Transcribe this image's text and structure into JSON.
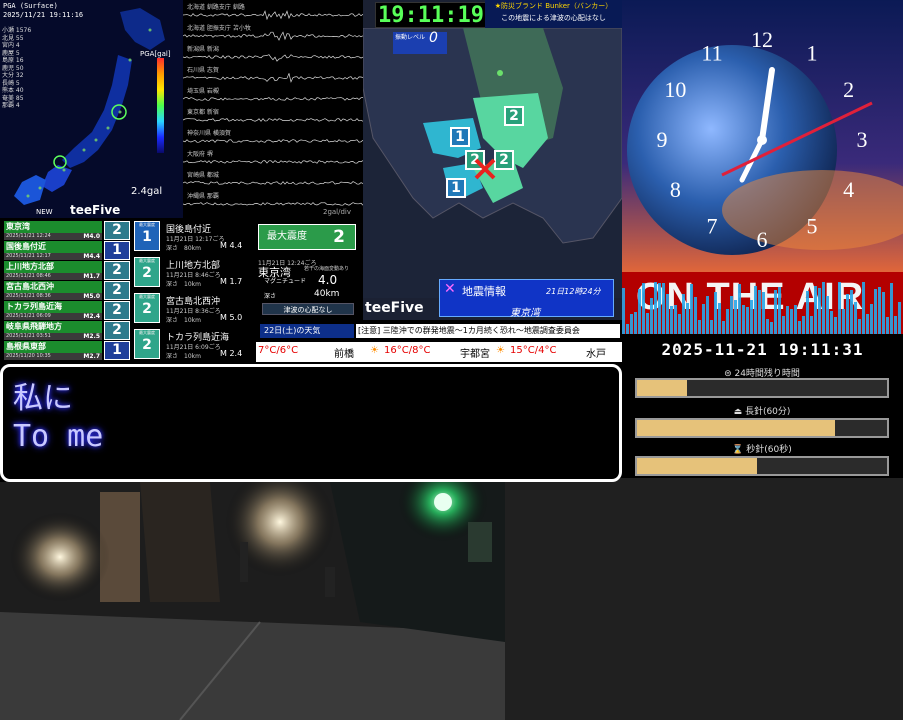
{
  "pga_panel": {
    "title": "PGA (Surface)",
    "timestamp": "2025/11/21 19:11:16",
    "legend": [
      "小瀬 1576",
      "北見 55",
      "宮内 4",
      "鹿屋 5",
      "島原 16",
      "鹿児 50",
      "大分 32",
      "長崎 5",
      "熊本 40",
      "奄美 85",
      "那覇 4"
    ],
    "scale_label": "PGA[gal]",
    "gal_value": "2.4gal",
    "new_label": "NEW",
    "brand": "teeFive",
    "colors": {
      "accent": "#1b8c2d"
    }
  },
  "seismograms": {
    "stations": [
      "北海道 釧路支庁 釧路",
      "北海道 胆振支庁 苫小牧",
      "新潟県 新潟",
      "石川県 志賀",
      "埼玉県 岩槻",
      "東京都 新宿",
      "神奈川県 横須賀",
      "大阪府 堺",
      "宮崎県 都城",
      "沖縄県 那覇"
    ],
    "footer": "2gal/div"
  },
  "kanto_map": {
    "clock": "19:11:19",
    "bunker_line1": "★防災ブランド Bunker（バンカー）",
    "bunker_line2": "この地震による津波の心配はなし",
    "level_label": "振動レベル",
    "level_value": "0",
    "intensity_marks": [
      "2",
      "1",
      "2",
      "2",
      "1"
    ],
    "brand": "teeFive",
    "info_title": "地震情報",
    "info_time": "21日12時24分",
    "info_epicenter": "東京湾"
  },
  "quake_list": [
    {
      "location": "東京湾",
      "datetime": "2025/11/21 12:24",
      "magnitude": "M4.0",
      "intensity": "2"
    },
    {
      "location": "国後島付近",
      "datetime": "2025/11/21 12:17",
      "magnitude": "M4.4",
      "intensity": "1"
    },
    {
      "location": "上川地方北部",
      "datetime": "2025/11/21 08:46",
      "magnitude": "M1.7",
      "intensity": "2"
    },
    {
      "location": "宮古島北西沖",
      "datetime": "2025/11/21 08:36",
      "magnitude": "M5.0",
      "intensity": "2"
    },
    {
      "location": "トカラ列島近海",
      "datetime": "2025/11/21 06:09",
      "magnitude": "M2.4",
      "intensity": "2"
    },
    {
      "location": "岐阜県飛騨地方",
      "datetime": "2025/11/21 03:51",
      "magnitude": "M2.5",
      "intensity": "2"
    },
    {
      "location": "島根県東部",
      "datetime": "2025/11/20 10:35",
      "magnitude": "M2.7",
      "intensity": "1"
    }
  ],
  "detail_cards": [
    {
      "badge_label": "最大震度",
      "intensity": "1",
      "name": "国後島付近",
      "time": "11月21日 12:17ごろ",
      "depth": "深さ　80km",
      "mag": "M 4.4"
    },
    {
      "badge_label": "最大震度",
      "intensity": "2",
      "name": "上川地方北部",
      "time": "11月21日 8:46ごろ",
      "depth": "深さ　10km",
      "mag": "M 1.7"
    },
    {
      "badge_label": "最大震度",
      "intensity": "2",
      "name": "宮古島北西沖",
      "time": "11月21日 8:36ごろ",
      "depth": "深さ　10km",
      "mag": "M 5.0"
    },
    {
      "badge_label": "最大震度",
      "intensity": "2",
      "name": "トカラ列島近海",
      "time": "11月21日 6:09ごろ",
      "depth": "深さ　10km",
      "mag": "M 2.4"
    }
  ],
  "max_panel": {
    "label": "最大震度",
    "value": "2",
    "time": "11月21日 12:24ごろ",
    "epicenter": "東京湾",
    "sub": "若干の海面変動あり",
    "mag_label": "マグニチュード",
    "mag_value": "4.0",
    "depth_label": "深さ",
    "depth_value": "40km",
    "tsunami": "津波の心配なし"
  },
  "ticker": {
    "day": "22日(土)の天気",
    "news": "[注意] 三陸沖での群発地震〜1カ月続く恐れ〜地震調査委員会",
    "weather": [
      {
        "text": "7°C/6°C",
        "color": "#e60000"
      },
      {
        "text": "前橋",
        "color": "#000000"
      },
      {
        "text": "16°C/8°C",
        "color": "#e60000"
      },
      {
        "text": "宇都宮",
        "color": "#000000"
      },
      {
        "text": "15°C/4°C",
        "color": "#e60000"
      },
      {
        "text": "水戸",
        "color": "#000000"
      }
    ]
  },
  "right_clock": {
    "numerals": [
      "12",
      "1",
      "2",
      "3",
      "4",
      "5",
      "6",
      "7",
      "8",
      "9",
      "10",
      "11"
    ],
    "on_air": "ON THE AIR",
    "datetime": "2025-11-21 19:11:31",
    "bars": [
      {
        "label": "24時間残り時間",
        "fraction": 0.2
      },
      {
        "label": "長針(60分)",
        "fraction": 0.79
      },
      {
        "label": "秒針(60秒)",
        "fraction": 0.48
      }
    ]
  },
  "subtitle": {
    "line1": "私に",
    "line2": "To me"
  }
}
